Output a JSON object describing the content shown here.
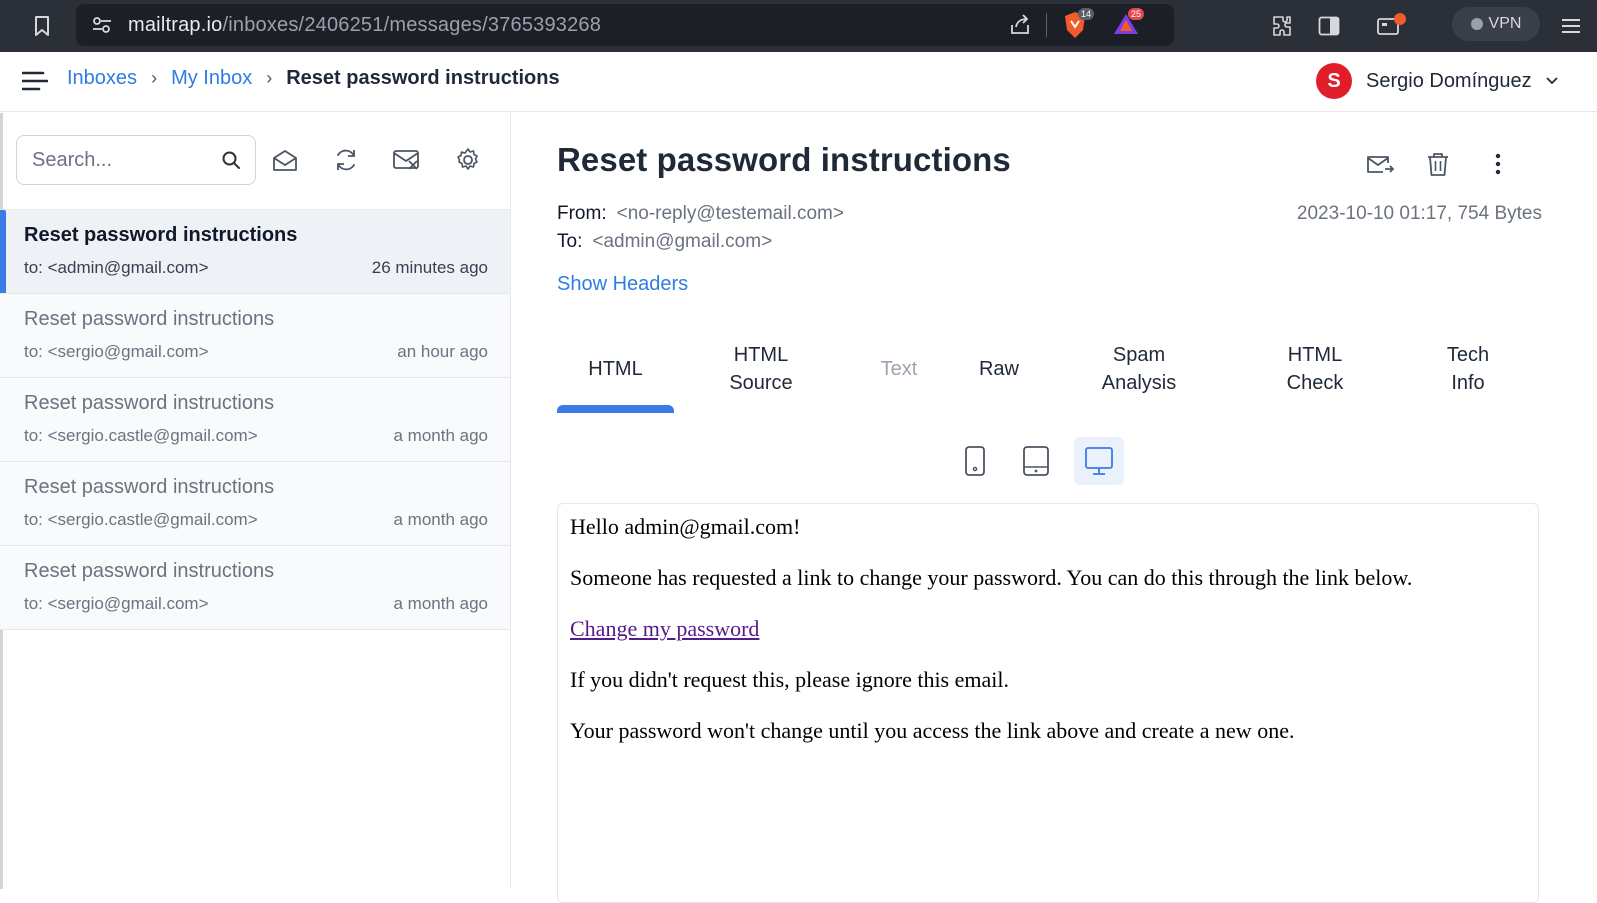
{
  "browser": {
    "url_host": "mailtrap.io",
    "url_path": "/inboxes/2406251/messages/3765393268",
    "brave_badge": "14",
    "rewards_badge": "25",
    "vpn_label": "VPN"
  },
  "header": {
    "breadcrumbs": [
      "Inboxes",
      "My Inbox",
      "Reset password instructions"
    ],
    "user_initial": "S",
    "user_name": "Sergio Domínguez"
  },
  "sidebar": {
    "search_placeholder": "Search...",
    "messages": [
      {
        "subject": "Reset password instructions",
        "to": "to: <admin@gmail.com>",
        "time": "26 minutes ago",
        "active": true
      },
      {
        "subject": "Reset password instructions",
        "to": "to: <sergio@gmail.com>",
        "time": "an hour ago",
        "active": false
      },
      {
        "subject": "Reset password instructions",
        "to": "to: <sergio.castle@gmail.com>",
        "time": "a month ago",
        "active": false
      },
      {
        "subject": "Reset password instructions",
        "to": "to: <sergio.castle@gmail.com>",
        "time": "a month ago",
        "active": false
      },
      {
        "subject": "Reset password instructions",
        "to": "to: <sergio@gmail.com>",
        "time": "a month ago",
        "active": false
      }
    ]
  },
  "message": {
    "title": "Reset password instructions",
    "from_label": "From:",
    "from_value": "<no-reply@testemail.com>",
    "to_label": "To:",
    "to_value": "<admin@gmail.com>",
    "date_size": "2023-10-10 01:17, 754 Bytes",
    "show_headers": "Show Headers",
    "tabs": [
      {
        "line1": "HTML",
        "line2": ""
      },
      {
        "line1": "HTML",
        "line2": "Source"
      },
      {
        "line1": "Text",
        "line2": ""
      },
      {
        "line1": "Raw",
        "line2": ""
      },
      {
        "line1": "Spam",
        "line2": "Analysis"
      },
      {
        "line1": "HTML",
        "line2": "Check"
      },
      {
        "line1": "Tech",
        "line2": "Info"
      }
    ],
    "body": {
      "greeting": "Hello admin@gmail.com!",
      "line1": "Someone has requested a link to change your password. You can do this through the link below.",
      "link": "Change my password",
      "line2": "If you didn't request this, please ignore this email.",
      "line3": "Your password won't change until you access the link above and create a new one."
    }
  },
  "colors": {
    "accent": "#3b7be8",
    "link": "#2f7de1",
    "avatar": "#e11d2a"
  }
}
